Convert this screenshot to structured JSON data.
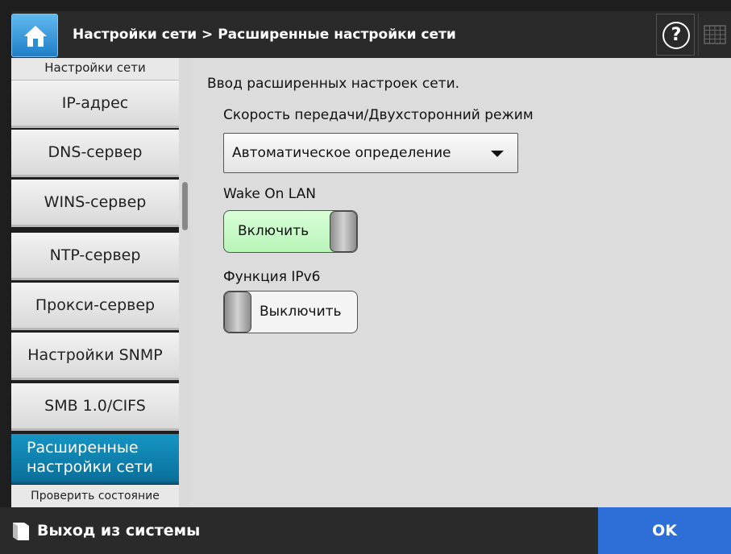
{
  "header": {
    "title": "Настройки сети > Расширенные настройки сети",
    "home_icon": "home-icon",
    "help_icon": "help-icon",
    "help_glyph": "?",
    "keyboard_icon": "keyboard-icon"
  },
  "sidebar": {
    "header": "Настройки сети",
    "items": [
      {
        "label": "IP-адрес",
        "active": false
      },
      {
        "label": "DNS-сервер",
        "active": false
      },
      {
        "label": "WINS-сервер",
        "active": false
      },
      {
        "label": "NTP-сервер",
        "active": false
      },
      {
        "label": "Прокси-сервер",
        "active": false
      },
      {
        "label": "Настройки SNMP",
        "active": false
      },
      {
        "label": "SMB 1.0/CIFS",
        "active": false
      },
      {
        "label": "Расширенные настройки сети",
        "active": true
      }
    ],
    "footer": "Проверить состояние"
  },
  "main": {
    "intro": "Ввод расширенных настроек сети.",
    "speed": {
      "label": "Скорость передачи/Двухсторонний режим",
      "value": "Автоматическое определение"
    },
    "wol": {
      "label": "Wake On LAN",
      "state_label": "Включить",
      "on": true
    },
    "ipv6": {
      "label": "Функция IPv6",
      "state_label": "Выключить",
      "on": false
    }
  },
  "footer": {
    "logout_label": "Выход из системы",
    "logout_icon": "book-icon",
    "ok_label": "OK"
  },
  "colors": {
    "active_item": "#0a7fb0",
    "toggle_on": "#c4f7c4",
    "ok_button": "#2d6fd6"
  }
}
